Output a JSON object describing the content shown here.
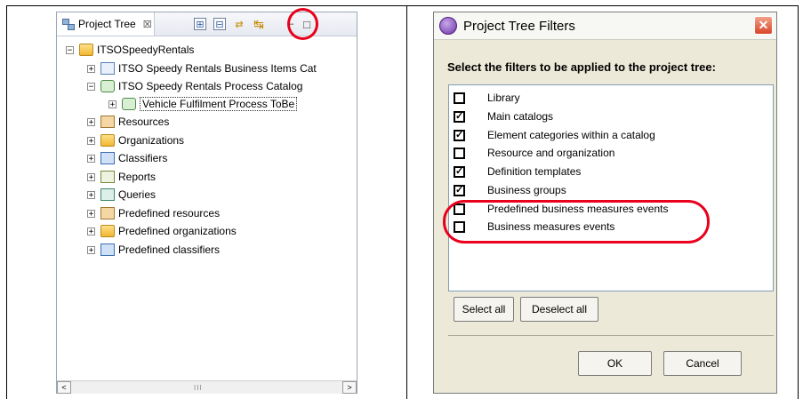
{
  "left_panel": {
    "tab_label": "Project Tree",
    "tab_close": "☒",
    "toolbar": {
      "expand_glyph": "⊞",
      "collapse_glyph": "⊟",
      "link_glyph": "⇄",
      "filter_glyph": "↹",
      "minimize_glyph": "–",
      "maximize_glyph": "□"
    },
    "tree": [
      {
        "label": "ITSOSpeedyRentals",
        "icon": "folder-open-icon",
        "expander": "−"
      },
      {
        "label": "ITSO Speedy Rentals Business Items Cat",
        "icon": "business-items-catalog-icon",
        "expander": "+"
      },
      {
        "label": "ITSO Speedy Rentals Process Catalog",
        "icon": "process-catalog-icon",
        "expander": "−"
      },
      {
        "label": "Vehicle Fulfilment Process ToBe",
        "icon": "process-icon",
        "expander": "+"
      },
      {
        "label": "Resources",
        "icon": "resources-icon",
        "expander": "+"
      },
      {
        "label": "Organizations",
        "icon": "organizations-icon",
        "expander": "+"
      },
      {
        "label": "Classifiers",
        "icon": "classifiers-icon",
        "expander": "+"
      },
      {
        "label": "Reports",
        "icon": "reports-icon",
        "expander": "+"
      },
      {
        "label": "Queries",
        "icon": "queries-icon",
        "expander": "+"
      },
      {
        "label": "Predefined resources",
        "icon": "resources-icon",
        "expander": "+"
      },
      {
        "label": "Predefined organizations",
        "icon": "organizations-icon",
        "expander": "+"
      },
      {
        "label": "Predefined classifiers",
        "icon": "classifiers-icon",
        "expander": "+"
      }
    ],
    "scrollbar": {
      "left_arrow": "<",
      "right_arrow": ">",
      "grip": "III"
    }
  },
  "dialog": {
    "title": "Project Tree Filters",
    "close_glyph": "✕",
    "prompt": "Select the filters to be applied to the project tree:",
    "filters": [
      {
        "label": "Library",
        "checked": false,
        "mark": ""
      },
      {
        "label": "Main catalogs",
        "checked": true,
        "mark": "✓"
      },
      {
        "label": "Element categories within a catalog",
        "checked": true,
        "mark": "✓"
      },
      {
        "label": "Resource and organization",
        "checked": false,
        "mark": ""
      },
      {
        "label": "Definition templates",
        "checked": true,
        "mark": "✓"
      },
      {
        "label": "Business groups",
        "checked": true,
        "mark": "✓"
      },
      {
        "label": "Predefined business measures events",
        "checked": false,
        "mark": ""
      },
      {
        "label": "Business measures events",
        "checked": false,
        "mark": ""
      }
    ],
    "select_all": "Select all",
    "deselect_all": "Deselect all",
    "ok": "OK",
    "cancel": "Cancel"
  },
  "colors": {
    "highlight": "#e8001c",
    "dialog_bg": "#ece9d8"
  }
}
